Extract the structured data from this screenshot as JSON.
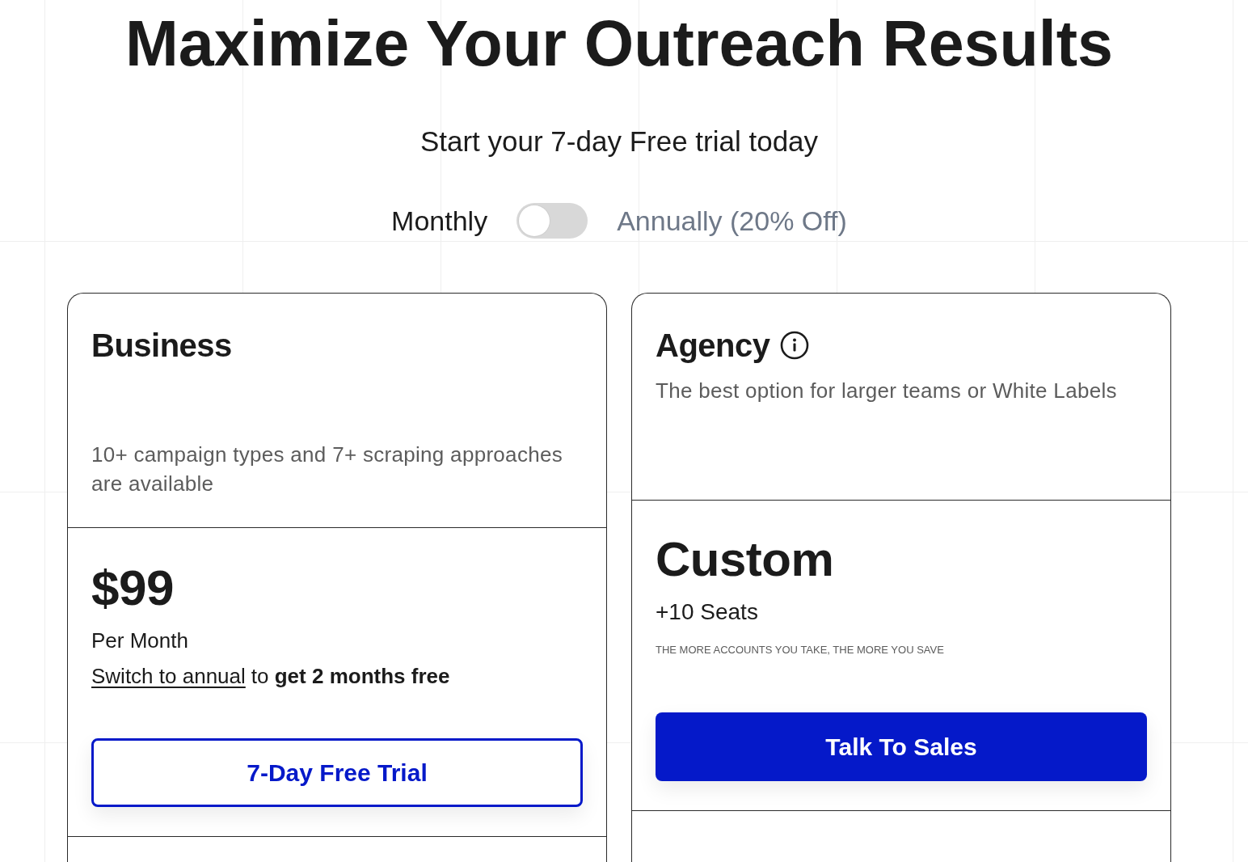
{
  "hero": {
    "title": "Maximize Your Outreach Results",
    "subtitle": "Start your 7-day Free trial today"
  },
  "billing": {
    "options": [
      {
        "label": "Monthly",
        "selected": true
      },
      {
        "label": "Annually (20% Off)",
        "selected": false
      }
    ],
    "toggle": {
      "on": false
    }
  },
  "plans": [
    {
      "kind": "standard",
      "name": "Business",
      "info": false,
      "description": "10+ campaign types and 7+ scraping approaches are available",
      "price": "$99",
      "period": "Per Month",
      "promo": {
        "link": "Switch to annual",
        "text": "to **get 2 months free**"
      },
      "button": {
        "label": "7-Day Free Trial"
      }
    },
    {
      "kind": "custom",
      "name": "Agency",
      "info": true,
      "description": "The best option for larger teams or White Labels",
      "price": "Custom",
      "seats": "+10 Seats",
      "fine_print": "THE MORE ACCOUNTS YOU TAKE, THE MORE YOU SAVE",
      "button": {
        "label": "Talk To Sales"
      }
    }
  ]
}
